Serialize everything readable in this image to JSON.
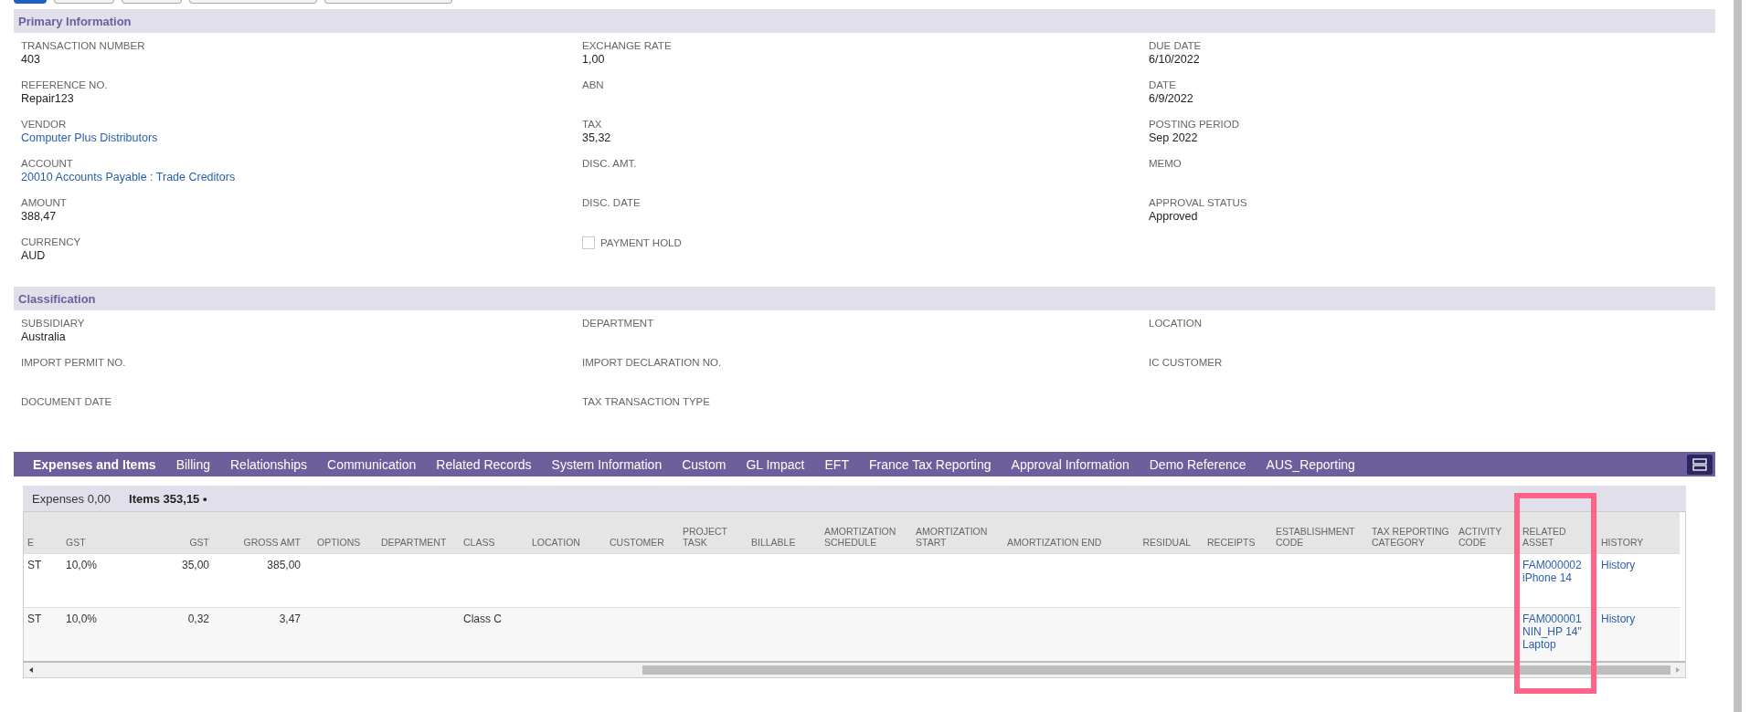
{
  "sections": [
    {
      "title": "Primary Information",
      "columns": [
        [
          {
            "label": "TRANSACTION NUMBER",
            "value": "403",
            "link": false
          },
          {
            "label": "REFERENCE NO.",
            "value": "Repair123",
            "link": false
          },
          {
            "label": "VENDOR",
            "value": "Computer Plus Distributors",
            "link": true
          },
          {
            "label": "ACCOUNT",
            "value": "20010 Accounts Payable : Trade Creditors",
            "link": true
          },
          {
            "label": "AMOUNT",
            "value": "388,47",
            "link": false
          },
          {
            "label": "CURRENCY",
            "value": "AUD",
            "link": false
          }
        ],
        [
          {
            "label": "EXCHANGE RATE",
            "value": "1,00",
            "link": false
          },
          {
            "label": "ABN"
          },
          {
            "label": "TAX",
            "value": "35,32",
            "link": false
          },
          {
            "label": "DISC. AMT."
          },
          {
            "label": "DISC. DATE"
          },
          {
            "kind": "checkbox",
            "label": "PAYMENT HOLD",
            "checked": false
          }
        ],
        [
          {
            "label": "DUE DATE",
            "value": "6/10/2022",
            "link": false
          },
          {
            "label": "DATE",
            "value": "6/9/2022",
            "link": false
          },
          {
            "label": "POSTING PERIOD",
            "value": "Sep 2022",
            "link": false
          },
          {
            "label": "MEMO"
          },
          {
            "label": "APPROVAL STATUS",
            "value": "Approved",
            "link": false
          }
        ]
      ]
    },
    {
      "title": "Classification",
      "columns": [
        [
          {
            "label": "SUBSIDIARY",
            "value": "Australia",
            "link": false
          },
          {
            "label": "IMPORT PERMIT NO."
          },
          {
            "label": "DOCUMENT DATE"
          }
        ],
        [
          {
            "label": "DEPARTMENT"
          },
          {
            "label": "IMPORT DECLARATION NO."
          },
          {
            "label": "TAX TRANSACTION TYPE"
          }
        ],
        [
          {
            "label": "LOCATION"
          },
          {
            "label": "IC CUSTOMER"
          }
        ]
      ]
    }
  ],
  "tabs": [
    {
      "label": "Expenses and Items",
      "selected": true
    },
    {
      "label": "Billing",
      "selected": false
    },
    {
      "label": "Relationships",
      "selected": false
    },
    {
      "label": "Communication",
      "selected": false
    },
    {
      "label": "Related Records",
      "selected": false
    },
    {
      "label": "System Information",
      "selected": false
    },
    {
      "label": "Custom",
      "selected": false
    },
    {
      "label": "GL Impact",
      "selected": false
    },
    {
      "label": "EFT",
      "selected": false
    },
    {
      "label": "France Tax Reporting",
      "selected": false
    },
    {
      "label": "Approval Information",
      "selected": false
    },
    {
      "label": "Demo Reference",
      "selected": false
    },
    {
      "label": "AUS_Reporting",
      "selected": false
    }
  ],
  "subtabs": [
    {
      "label": "Expenses 0,00",
      "selected": false
    },
    {
      "label": "Items 353,15 •",
      "selected": true
    }
  ],
  "table": {
    "columns": [
      {
        "label": "E",
        "kind": "text"
      },
      {
        "label": "GST",
        "kind": "text"
      },
      {
        "label": "GST",
        "kind": "number"
      },
      {
        "label": "GROSS AMT",
        "kind": "number"
      },
      {
        "label": "OPTIONS",
        "kind": "text"
      },
      {
        "label": "DEPARTMENT",
        "kind": "text"
      },
      {
        "label": "CLASS",
        "kind": "text"
      },
      {
        "label": "LOCATION",
        "kind": "text"
      },
      {
        "label": "CUSTOMER",
        "kind": "text"
      },
      {
        "label": "PROJECT TASK",
        "kind": "text"
      },
      {
        "label": "BILLABLE",
        "kind": "text"
      },
      {
        "label": "AMORTIZATION SCHEDULE",
        "kind": "text"
      },
      {
        "label": "AMORTIZATION START",
        "kind": "text"
      },
      {
        "label": "AMORTIZATION END",
        "kind": "text"
      },
      {
        "label": "RESIDUAL",
        "kind": "number"
      },
      {
        "label": "RECEIPTS",
        "kind": "text"
      },
      {
        "label": "ESTABLISHMENT CODE",
        "kind": "text"
      },
      {
        "label": "TAX REPORTING CATEGORY",
        "kind": "text"
      },
      {
        "label": "ACTIVITY CODE",
        "kind": "text"
      },
      {
        "label": "RELATED ASSET",
        "kind": "link"
      },
      {
        "label": "HISTORY",
        "kind": "link"
      }
    ],
    "rows": [
      {
        "cells": [
          "ST",
          "10,0%",
          "35,00",
          "385,00",
          "",
          "",
          "",
          "",
          "",
          "",
          "",
          "",
          "",
          "",
          "",
          "",
          "",
          "",
          "",
          "FAM000002 iPhone 14",
          "History"
        ]
      },
      {
        "cells": [
          "ST",
          "10,0%",
          "0,32",
          "3,47",
          "",
          "",
          "Class C",
          "",
          "",
          "",
          "",
          "",
          "",
          "",
          "",
          "",
          "",
          "",
          "",
          "FAM000001 NIN_HP 14\" Laptop",
          "History"
        ]
      }
    ]
  }
}
